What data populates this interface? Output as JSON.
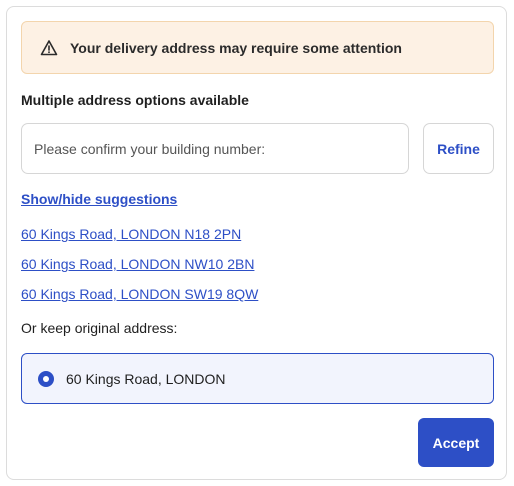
{
  "warning": {
    "icon": "warning-triangle-icon",
    "text": "Your delivery address may require some attention",
    "color": "#fdf1e4"
  },
  "section_title": "Multiple address options available",
  "building_input": {
    "value": "",
    "placeholder": "Please confirm your building number:"
  },
  "refine_label": "Refine",
  "toggle_label": "Show/hide suggestions",
  "suggestions": [
    "60 Kings Road, LONDON N18 2PN",
    "60 Kings Road, LONDON NW10 2BN",
    "60 Kings Road, LONDON SW19 8QW"
  ],
  "keep_original_label": "Or keep original address:",
  "original_address": {
    "label": "60 Kings Road, LONDON",
    "selected": true
  },
  "accept_label": "Accept",
  "colors": {
    "accent": "#2d4fc6",
    "warning_bg": "#fdf1e4",
    "warning_border": "#f3d5ad",
    "selected_bg": "#f2f4fd"
  }
}
